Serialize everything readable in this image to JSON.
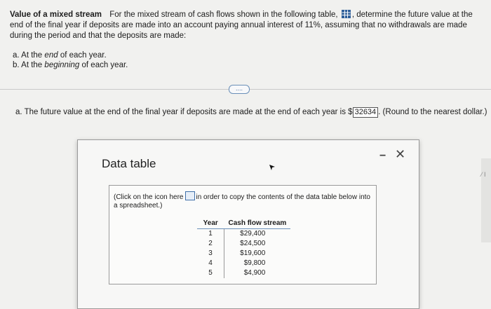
{
  "problem": {
    "title": "Value of a mixed stream",
    "text_before_icon": "For the mixed stream of cash flows shown in the following table,",
    "text_after_icon": ", determine the future value at the end of the final year if deposits are made into an account paying annual interest of 11%, assuming that no withdrawals are made during the period and that the deposits are made:",
    "parts": [
      {
        "label": "a.",
        "pre": "At the",
        "em": "end",
        "post": "of each year."
      },
      {
        "label": "b.",
        "pre": "At the",
        "em": "beginning",
        "post": "of each year."
      }
    ]
  },
  "more_button": "....",
  "answer": {
    "label": "a.",
    "text": "The future value at the end of the final year if deposits are made at the end of each year is",
    "currency": "$",
    "value": "32634",
    "suffix": ". (Round to the nearest dollar.)"
  },
  "modal": {
    "title": "Data table",
    "minimize": "−",
    "close": "✕",
    "hint_before": "(Click on the icon here",
    "hint_after": "in order to copy the contents of the data table below into a spreadsheet.)",
    "table": {
      "headers": [
        "Year",
        "Cash flow stream"
      ],
      "rows": [
        [
          "1",
          "$29,400"
        ],
        [
          "2",
          "$24,500"
        ],
        [
          "3",
          "$19,600"
        ],
        [
          "4",
          "$9,800"
        ],
        [
          "5",
          "$4,900"
        ]
      ]
    }
  },
  "edge_label": "⁄ I"
}
